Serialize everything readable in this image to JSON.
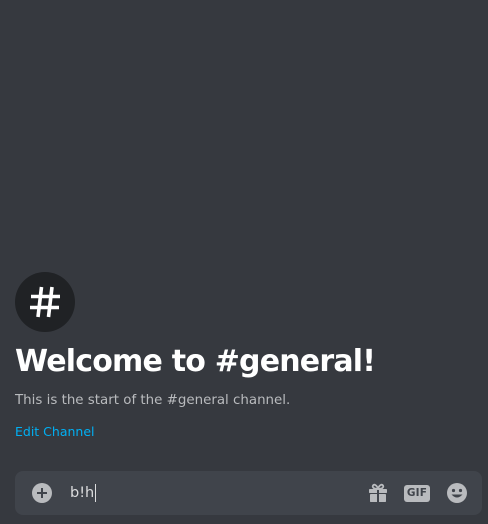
{
  "welcome": {
    "icon": "hash-icon",
    "title": "Welcome to #general!",
    "subtitle": "This is the start of the #general channel.",
    "edit_link": "Edit Channel"
  },
  "composer": {
    "value": "b!h",
    "icons": [
      "add-circle-icon",
      "gift-icon",
      "gif-icon",
      "emoji-icon"
    ],
    "gif_label": "GIF"
  },
  "colors": {
    "background": "#36393f",
    "composer_bg": "#40444b",
    "icon_circle": "#202225",
    "link": "#00b0f4",
    "muted_text": "#b9bbbe"
  }
}
